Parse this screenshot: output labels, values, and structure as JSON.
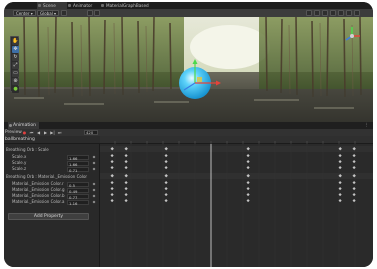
{
  "tabs": [
    {
      "label": "Scene",
      "active": true
    },
    {
      "label": "Animator",
      "active": false
    },
    {
      "label": "MaterialGraphBased",
      "active": false
    }
  ],
  "scene_toolbar": {
    "center_label": "Center",
    "global_label": "Global"
  },
  "animation_window": {
    "tab_label": "Animation",
    "preview_label": "Preview",
    "frame_value": "420",
    "clip_name": "ballbreathing",
    "add_property_label": "Add Property",
    "properties": [
      {
        "group": true,
        "label": "Breathing Orb : Scale"
      },
      {
        "group": false,
        "label": "Scale.x",
        "value": "1.66"
      },
      {
        "group": false,
        "label": "Scale.y",
        "value": "1.66"
      },
      {
        "group": false,
        "label": "Scale.z",
        "value": "0.71"
      },
      {
        "group": true,
        "label": "Breathing Orb : Material._Emission Color"
      },
      {
        "group": false,
        "label": "Material._Emission Color.r",
        "value": "0.5"
      },
      {
        "group": false,
        "label": "Material._Emission Color.g",
        "value": "0.49"
      },
      {
        "group": false,
        "label": "Material._Emission Color.b",
        "value": "0.77"
      },
      {
        "group": false,
        "label": "Material._Emission Color.a",
        "value": "1.16"
      }
    ]
  },
  "colors": {
    "accent": "#3e6fa8",
    "orb": "#29b6f1",
    "playhead": "#ffffff"
  }
}
